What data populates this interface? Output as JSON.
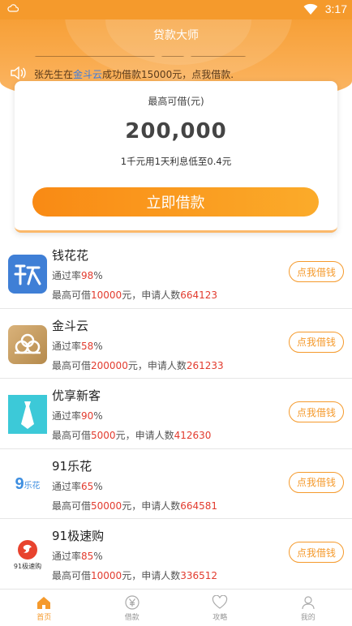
{
  "status_bar": {
    "time": "3:17"
  },
  "header": {
    "app_title": "贷款大师",
    "ticker": {
      "prefix": "张先生在",
      "platform": "金斗云",
      "suffix": "成功借款15000元，点我借款."
    }
  },
  "loan_card": {
    "label": "最高可借(元)",
    "amount": "200,000",
    "note": "1千元用1天利息低至0.4元",
    "cta_label": "立即借款"
  },
  "products": [
    {
      "name": "钱花花",
      "rate_label": "通过率",
      "rate": "98",
      "rate_unit": "%",
      "limit_label": "最高可借",
      "limit": "10000",
      "limit_unit": "元，申请人数",
      "applicants": "664123",
      "button": "点我借钱",
      "logo_icon": "qianhuahua-logo",
      "logo_color": "#3f7fd6"
    },
    {
      "name": "金斗云",
      "rate_label": "通过率",
      "rate": "58",
      "rate_unit": "%",
      "limit_label": "最高可借",
      "limit": "200000",
      "limit_unit": "元，申请人数",
      "applicants": "261233",
      "button": "点我借钱",
      "logo_icon": "jindouyun-logo",
      "logo_color": "#c9a063"
    },
    {
      "name": "优享新客",
      "rate_label": "通过率",
      "rate": "90",
      "rate_unit": "%",
      "limit_label": "最高可借",
      "limit": "5000",
      "limit_unit": "元，申请人数",
      "applicants": "412630",
      "button": "点我借钱",
      "logo_icon": "youxiang-logo",
      "logo_color": "#3cc9d8"
    },
    {
      "name": "91乐花",
      "rate_label": "通过率",
      "rate": "65",
      "rate_unit": "%",
      "limit_label": "最高可借",
      "limit": "50000",
      "limit_unit": "元，申请人数",
      "applicants": "664581",
      "button": "点我借钱",
      "logo_icon": "91lehua-logo",
      "logo_color": "#3d8ee0",
      "logo_text": "乐花"
    },
    {
      "name": "91极速购",
      "rate_label": "通过率",
      "rate": "85",
      "rate_unit": "%",
      "limit_label": "最高可借",
      "limit": "10000",
      "limit_unit": "元，申请人数",
      "applicants": "336512",
      "button": "点我借钱",
      "logo_icon": "91jisugou-logo",
      "logo_color": "#e8432e",
      "logo_text": "91极速购"
    }
  ],
  "tabs": [
    {
      "label": "首页",
      "icon": "home-icon",
      "active": true
    },
    {
      "label": "借款",
      "icon": "yen-icon",
      "active": false
    },
    {
      "label": "攻略",
      "icon": "heart-icon",
      "active": false
    },
    {
      "label": "我的",
      "icon": "user-icon",
      "active": false
    }
  ],
  "colors": {
    "accent": "#f59a2c",
    "highlight": "#e23b2e",
    "link": "#3b7be0"
  }
}
